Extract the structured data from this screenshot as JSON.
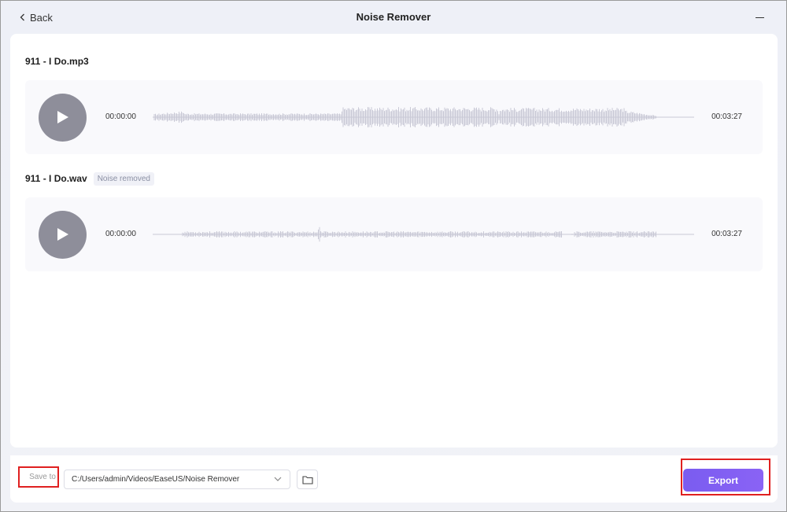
{
  "titlebar": {
    "back_label": "Back",
    "title": "Noise Remover"
  },
  "tracks": [
    {
      "file_name": "911 - I Do.mp3",
      "badge": "",
      "start_time": "00:00:00",
      "end_time": "00:03:27",
      "wave_style": "dense"
    },
    {
      "file_name": "911 - I Do.wav",
      "badge": "Noise removed",
      "start_time": "00:00:00",
      "end_time": "00:03:27",
      "wave_style": "sparse"
    }
  ],
  "footer": {
    "save_to_label": "Save to",
    "save_path": "C:/Users/admin/Videos/EaseUS/Noise Remover",
    "export_label": "Export"
  },
  "colors": {
    "accent": "#7a5cf0",
    "highlight": "#e02020",
    "waveform": "#c9c9d6",
    "play_button": "#8e8e9a"
  },
  "icons": {
    "back": "chevron-left-icon",
    "minimize": "minimize-icon",
    "play": "play-icon",
    "dropdown": "chevron-down-icon",
    "folder": "folder-icon"
  }
}
